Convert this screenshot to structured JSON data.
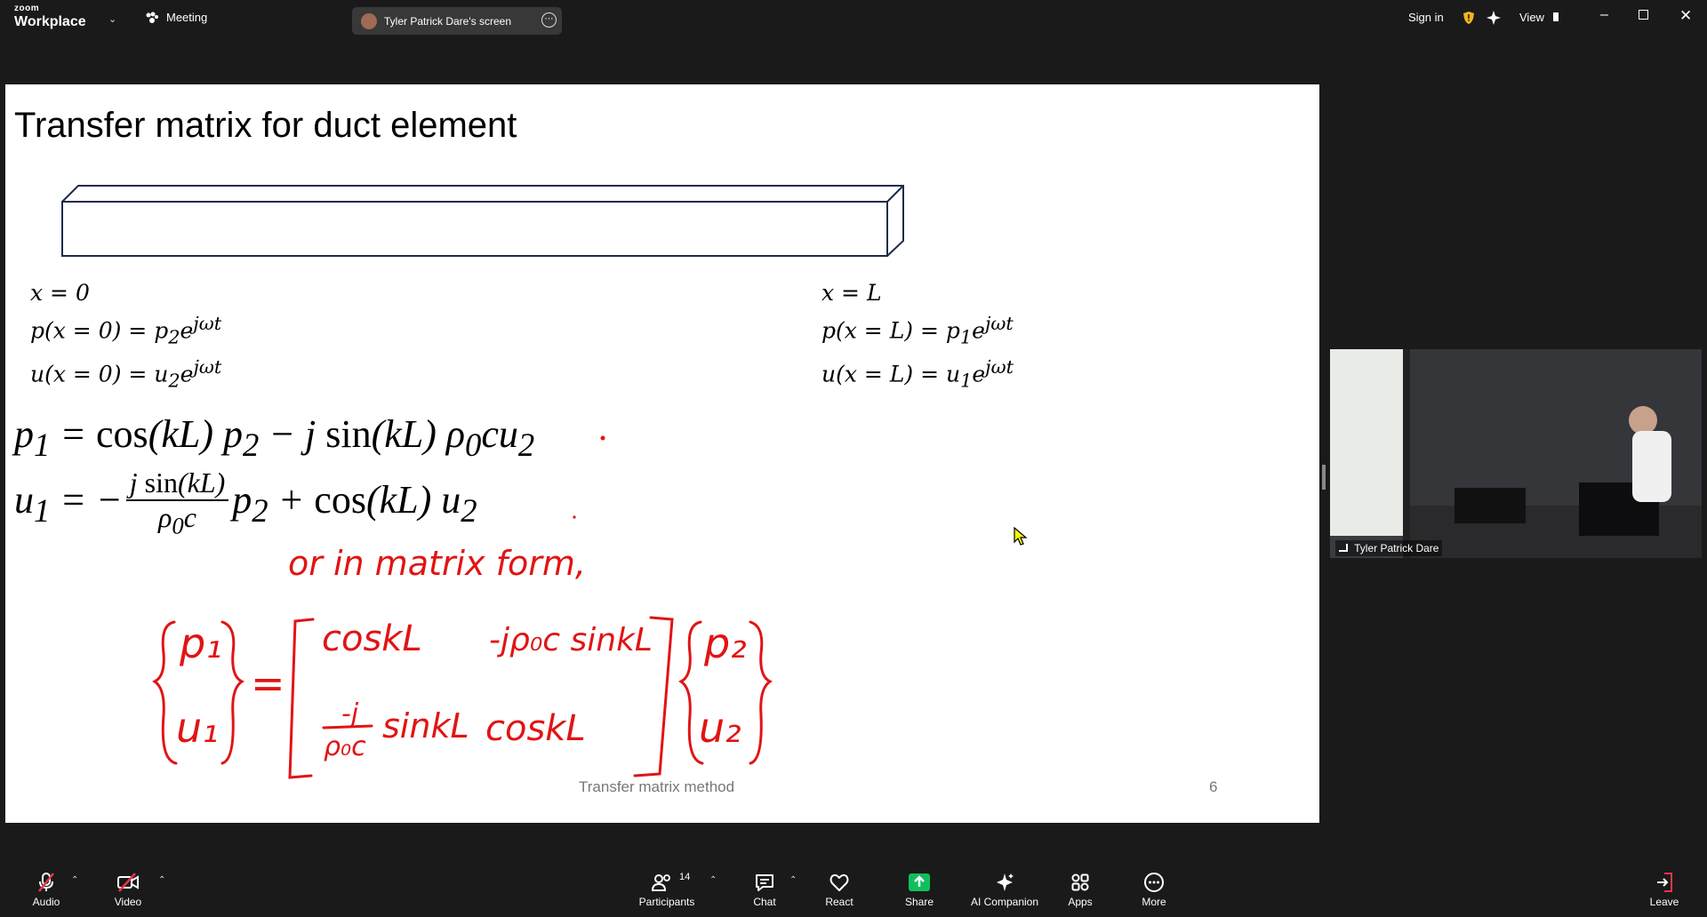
{
  "app": {
    "brand_small": "zoom",
    "brand_big": "Workplace"
  },
  "topbar": {
    "meeting_label": "Meeting",
    "screen_label": "Tyler Patrick Dare's screen",
    "sign_in": "Sign in",
    "view": "View"
  },
  "slide": {
    "title": "Transfer matrix for duct element",
    "left_conditions": [
      "x = 0",
      "p(x = 0) = p₂e^{jωt}",
      "u(x = 0) = u₂e^{jωt}"
    ],
    "right_conditions": [
      "x = L",
      "p(x = L) = p₁e^{jωt}",
      "u(x = L) = u₁e^{jωt}"
    ],
    "equation1": "p₁ = cos(kL) p₂ − j sin(kL) ρ₀cu₂",
    "equation2_left": "u₁ = −",
    "equation2_num": "j sin(kL)",
    "equation2_den": "ρ₀c",
    "equation2_right": "p₂ + cos(kL) u₂",
    "handwriting": {
      "note": "or in matrix form,",
      "lhs_top": "p₁",
      "lhs_bottom": "u₁",
      "m11": "coskL",
      "m12": "-jρ₀c sinkL",
      "m21_num": "-j",
      "m21_den": "ρ₀c",
      "m21_tail": "sinkL",
      "m22": "coskL",
      "rhs_top": "p₂",
      "rhs_bottom": "u₂"
    },
    "footer": "Transfer matrix method",
    "page_number": "6",
    "ink_color": "#e11414"
  },
  "video": {
    "participant_name": "Tyler Patrick Dare"
  },
  "toolbar": {
    "audio": "Audio",
    "video": "Video",
    "participants": "Participants",
    "participants_count": "14",
    "chat": "Chat",
    "react": "React",
    "share": "Share",
    "ai_companion": "AI Companion",
    "apps": "Apps",
    "more": "More",
    "leave": "Leave"
  },
  "colors": {
    "share_green": "#0fbf5b",
    "mute_red": "#e8364b",
    "shield_yellow": "#f2b51d"
  }
}
